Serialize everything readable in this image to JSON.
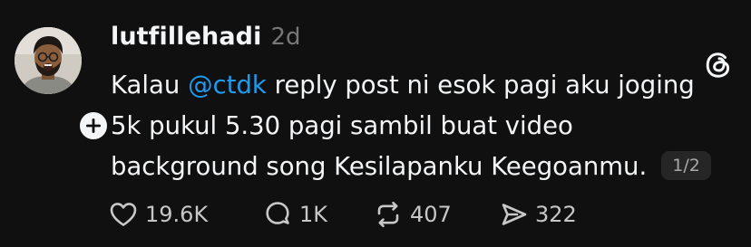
{
  "post": {
    "username": "lutfillehadi",
    "timestamp": "2d",
    "text_segments": {
      "line1_prefix": "Kalau ",
      "mention": "@ctdk",
      "line1_suffix": " reply post ni esok pagi aku joging",
      "line2": "5k pukul 5.30 pagi sambil buat video",
      "line3": "background song Kesilapanku Keegoanmu."
    },
    "page_indicator": "1/2",
    "mention_color": "#1d9bf0"
  },
  "actions": {
    "likes": "19.6K",
    "replies": "1K",
    "reposts": "407",
    "shares": "322"
  },
  "icons": {
    "follow": "plus-icon",
    "platform": "threads-logo-icon",
    "like": "heart-icon",
    "reply": "comment-icon",
    "repost": "repost-icon",
    "share": "share-icon"
  },
  "colors": {
    "background": "#101010",
    "text": "#f3f5f7",
    "muted": "#777777"
  }
}
